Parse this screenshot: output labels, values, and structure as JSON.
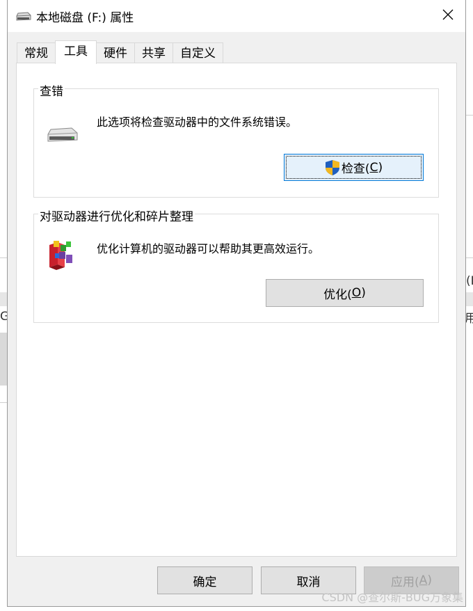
{
  "window": {
    "title": "本地磁盘 (F:) 属性"
  },
  "tabs": [
    {
      "label": "常规",
      "active": false
    },
    {
      "label": "工具",
      "active": true
    },
    {
      "label": "硬件",
      "active": false
    },
    {
      "label": "共享",
      "active": false
    },
    {
      "label": "自定义",
      "active": false
    }
  ],
  "error_check": {
    "title": "查错",
    "description": "此选项将检查驱动器中的文件系统错误。",
    "button_label": "检查(",
    "button_key": "C",
    "button_suffix": ")"
  },
  "optimize": {
    "title": "对驱动器进行优化和碎片整理",
    "description": "优化计算机的驱动器可以帮助其更高效运行。",
    "button_label": "优化(",
    "button_key": "O",
    "button_suffix": ")"
  },
  "footer": {
    "ok": "确定",
    "cancel": "取消",
    "apply": "应用(",
    "apply_key": "A",
    "apply_suffix": ")"
  },
  "background": {
    "fragment_right_1": "(I",
    "fragment_right_2": "用",
    "fragment_left": "G"
  },
  "watermark": "CSDN @查尔斯-BUG万象集",
  "colors": {
    "accent": "#0078d7",
    "shield_blue": "#1f5fbf",
    "shield_yellow": "#f2b71f"
  }
}
